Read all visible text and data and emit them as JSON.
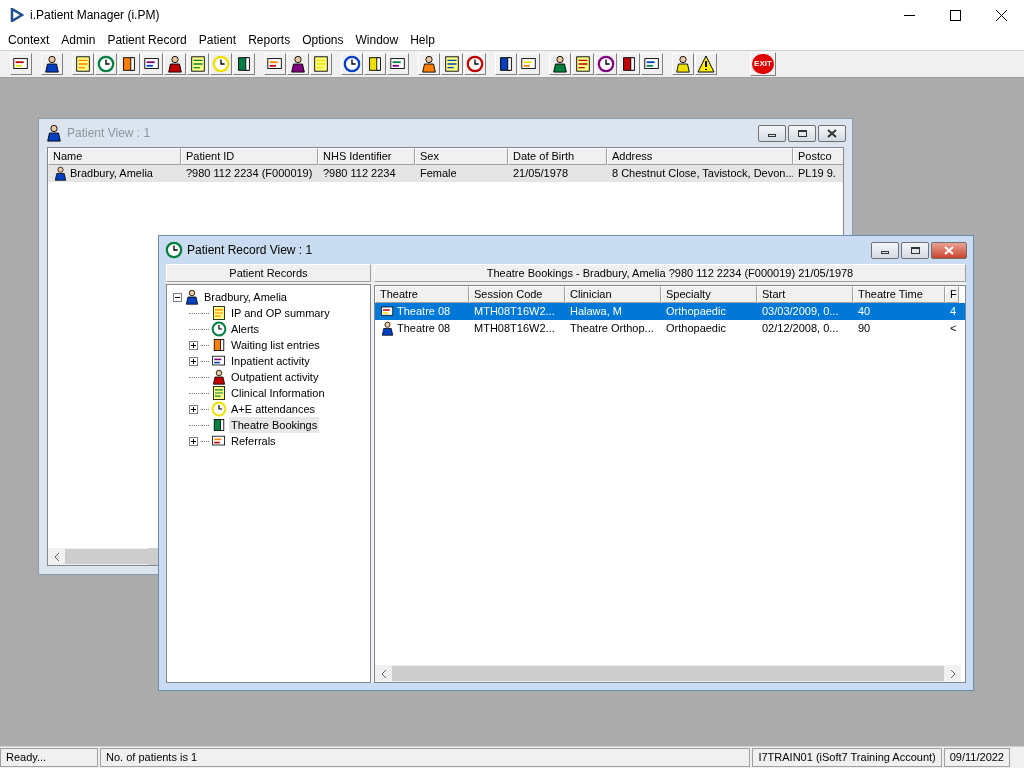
{
  "app": {
    "title": "i.Patient Manager (i.PM)",
    "menu": [
      "Context",
      "Admin",
      "Patient Record",
      "Patient",
      "Reports",
      "Options",
      "Window",
      "Help"
    ],
    "exit_label": "EXIT"
  },
  "patient_view": {
    "title": "Patient View : 1",
    "active": false,
    "columns": [
      "Name",
      "Patient ID",
      "NHS Identifier",
      "Sex",
      "Date of Birth",
      "Address",
      "Postco"
    ],
    "rows": [
      {
        "selected": true,
        "cells": [
          "Bradbury, Amelia",
          "?980 112 2234 (F000019)",
          "?980 112 2234",
          "Female",
          "21/05/1978",
          "8 Chestnut Close, Tavistock, Devon...",
          "PL19 9."
        ]
      }
    ]
  },
  "record_view": {
    "title": "Patient Record View : 1",
    "active": true,
    "tree_header": "Patient Records",
    "tree": [
      {
        "label": "Bradbury, Amelia",
        "expanded": true,
        "selected": false,
        "children": [
          {
            "label": "IP and OP summary",
            "has_children": false,
            "selected": false
          },
          {
            "label": "Alerts",
            "has_children": false,
            "selected": false
          },
          {
            "label": "Waiting list entries",
            "has_children": true,
            "selected": false
          },
          {
            "label": "Inpatient activity",
            "has_children": true,
            "selected": false
          },
          {
            "label": "Outpatient activity",
            "has_children": false,
            "selected": false
          },
          {
            "label": "Clinical Information",
            "has_children": false,
            "selected": false
          },
          {
            "label": "A+E attendances",
            "has_children": true,
            "selected": false
          },
          {
            "label": "Theatre Bookings",
            "has_children": false,
            "selected": true
          },
          {
            "label": "Referrals",
            "has_children": true,
            "selected": false
          }
        ]
      }
    ],
    "detail_header": "Theatre Bookings - Bradbury, Amelia ?980 112 2234 (F000019) 21/05/1978",
    "columns": [
      "Theatre",
      "Session Code",
      "Clinician",
      "Specialty",
      "Start",
      "Theatre Time",
      "F"
    ],
    "rows": [
      {
        "selected": true,
        "cells": [
          "Theatre 08",
          "MTH08T16W2...",
          "Halawa, M",
          "Orthopaedic",
          "03/03/2009, 0...",
          "40",
          "4"
        ]
      },
      {
        "selected": false,
        "cells": [
          "Theatre 08",
          "MTH08T16W2...",
          "Theatre Orthop...",
          "Orthopaedic",
          "02/12/2008, 0...",
          "90",
          "<"
        ]
      }
    ]
  },
  "status_bar": [
    "Ready...",
    "No. of patients is 1",
    "I7TRAIN01 (iSoft7 Training Account)",
    "09/11/2022"
  ]
}
